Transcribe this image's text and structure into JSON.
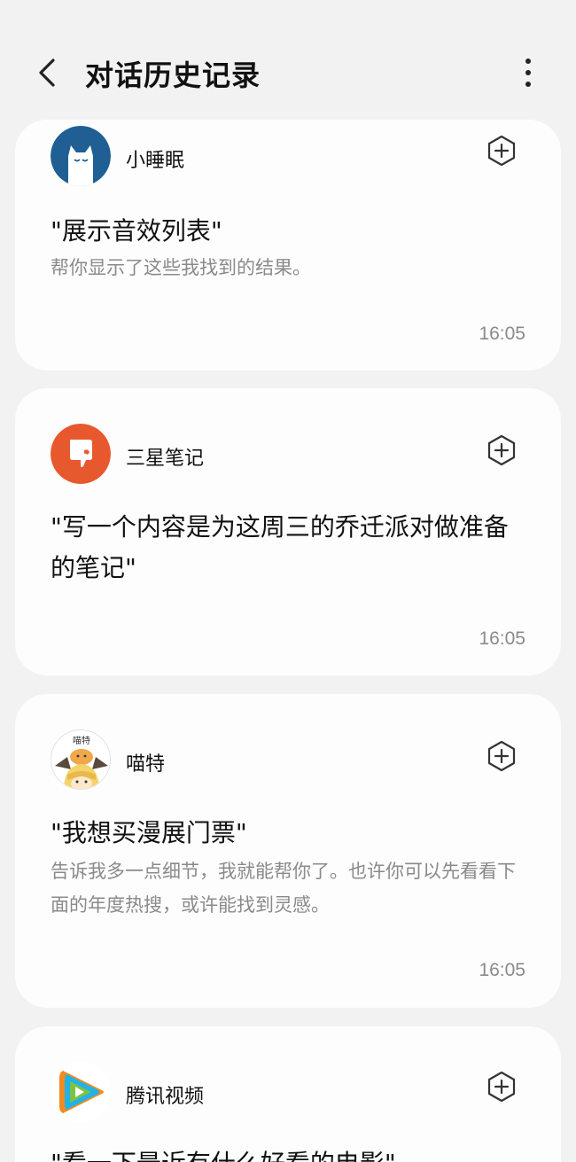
{
  "header": {
    "title": "对话历史记录"
  },
  "cards": [
    {
      "app": "小睡眠",
      "icon": "cat-app-icon",
      "query": "\"展示音效列表\"",
      "reply": "帮你显示了这些我找到的结果。",
      "time": "16:05"
    },
    {
      "app": "三星笔记",
      "icon": "notes-app-icon",
      "query": "\"写一个内容是为这周三的乔迁派对做准备的笔记\"",
      "reply": "",
      "time": "16:05"
    },
    {
      "app": "喵特",
      "icon": "meow-app-icon",
      "icon_text": "喵特",
      "query": "\"我想买漫展门票\"",
      "reply": "告诉我多一点细节，我就能帮你了。也许你可以先看看下面的年度热搜，或许能找到灵感。",
      "time": "16:05"
    },
    {
      "app": "腾讯视频",
      "icon": "video-app-icon",
      "query": "\"看一下最近有什么好看的电影\"",
      "reply": "",
      "time": ""
    }
  ],
  "colors": {
    "background": "#f2f2f2",
    "card": "#fdfdfd",
    "secondary_text": "#8a8a8a",
    "sleep_blue": "#1f5f94",
    "notes_orange": "#e8582e"
  }
}
